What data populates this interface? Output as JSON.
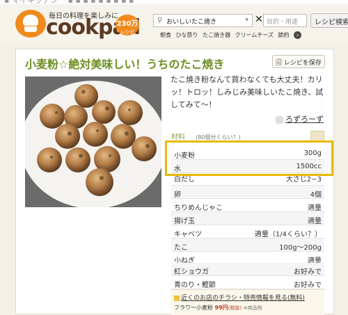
{
  "header": {
    "tagline": "毎日の料理を楽しみに",
    "wordmark": "cookpad",
    "recipe_count": "230万",
    "recipe_count_unit": "レシピ",
    "search_value": "おいしいたこ焼き",
    "purpose_placeholder": "目的・用途",
    "search_button": "レシピ検索",
    "popular": [
      "朝食",
      "ひな祭り",
      "たこ焼き器",
      "クリームチーズ",
      "節約"
    ]
  },
  "recipe": {
    "title": "小麦粉☆絶対美味しい！うちのたこ焼き",
    "save_button": "レシピを保存",
    "description": "たこ焼き粉なんて買わなくても大丈夫！カリッ！トロッ！しみじみ美味しいたこ焼き、試してみて～！",
    "author": "ろずろーず",
    "ingredients_heading": "材料",
    "servings": "(80個分くらい？)",
    "ingredients": [
      {
        "name": "小麦粉",
        "amount": "300g"
      },
      {
        "name": "水",
        "amount": "1500cc"
      },
      {
        "name": "白だし",
        "amount": "大さじ2~3"
      },
      {
        "name": "卵",
        "amount": "4個"
      },
      {
        "name": "ちりめんじゃこ",
        "amount": "適量"
      },
      {
        "name": "揚げ玉",
        "amount": "適量"
      },
      {
        "name": "キャベツ",
        "amount": "適量（1/4くらい？）"
      },
      {
        "name": "たこ",
        "amount": "100g〜200g"
      },
      {
        "name": "小ねぎ",
        "amount": "適量"
      },
      {
        "name": "紅ショウガ",
        "amount": "お好みで"
      },
      {
        "name": "青のり・鰹節",
        "amount": "お好みで"
      }
    ]
  },
  "promo": {
    "link": "近くのお店のチラシ・特売情報を見る(無料)",
    "product": "フラワー小麦粉",
    "price": "99円",
    "tax": "(税抜)",
    "note": "※商品例"
  },
  "colors": {
    "brand_orange": "#f08a1d",
    "title_green": "#6b8e1f",
    "highlight_yellow": "#e8b800"
  }
}
